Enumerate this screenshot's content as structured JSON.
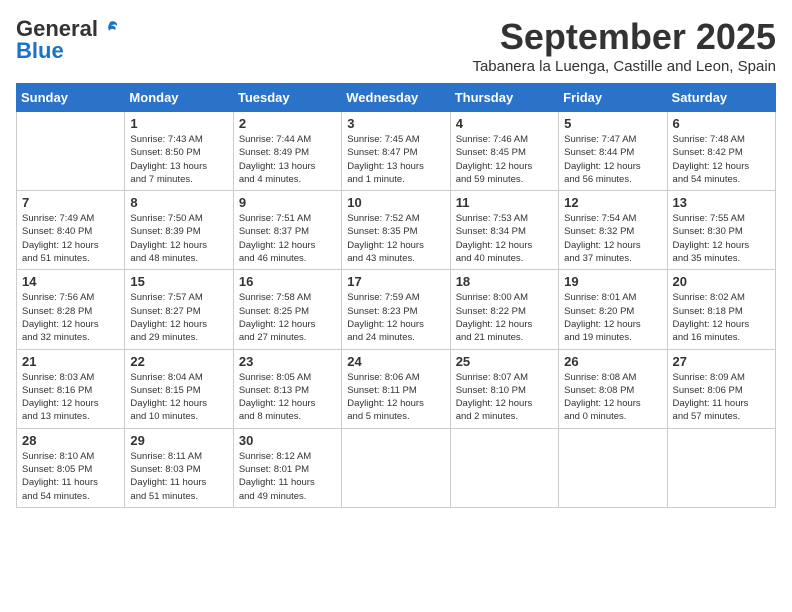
{
  "header": {
    "logo_general": "General",
    "logo_blue": "Blue",
    "month": "September 2025",
    "location": "Tabanera la Luenga, Castille and Leon, Spain"
  },
  "weekdays": [
    "Sunday",
    "Monday",
    "Tuesday",
    "Wednesday",
    "Thursday",
    "Friday",
    "Saturday"
  ],
  "weeks": [
    [
      {
        "day": "",
        "info": ""
      },
      {
        "day": "1",
        "info": "Sunrise: 7:43 AM\nSunset: 8:50 PM\nDaylight: 13 hours\nand 7 minutes."
      },
      {
        "day": "2",
        "info": "Sunrise: 7:44 AM\nSunset: 8:49 PM\nDaylight: 13 hours\nand 4 minutes."
      },
      {
        "day": "3",
        "info": "Sunrise: 7:45 AM\nSunset: 8:47 PM\nDaylight: 13 hours\nand 1 minute."
      },
      {
        "day": "4",
        "info": "Sunrise: 7:46 AM\nSunset: 8:45 PM\nDaylight: 12 hours\nand 59 minutes."
      },
      {
        "day": "5",
        "info": "Sunrise: 7:47 AM\nSunset: 8:44 PM\nDaylight: 12 hours\nand 56 minutes."
      },
      {
        "day": "6",
        "info": "Sunrise: 7:48 AM\nSunset: 8:42 PM\nDaylight: 12 hours\nand 54 minutes."
      }
    ],
    [
      {
        "day": "7",
        "info": "Sunrise: 7:49 AM\nSunset: 8:40 PM\nDaylight: 12 hours\nand 51 minutes."
      },
      {
        "day": "8",
        "info": "Sunrise: 7:50 AM\nSunset: 8:39 PM\nDaylight: 12 hours\nand 48 minutes."
      },
      {
        "day": "9",
        "info": "Sunrise: 7:51 AM\nSunset: 8:37 PM\nDaylight: 12 hours\nand 46 minutes."
      },
      {
        "day": "10",
        "info": "Sunrise: 7:52 AM\nSunset: 8:35 PM\nDaylight: 12 hours\nand 43 minutes."
      },
      {
        "day": "11",
        "info": "Sunrise: 7:53 AM\nSunset: 8:34 PM\nDaylight: 12 hours\nand 40 minutes."
      },
      {
        "day": "12",
        "info": "Sunrise: 7:54 AM\nSunset: 8:32 PM\nDaylight: 12 hours\nand 37 minutes."
      },
      {
        "day": "13",
        "info": "Sunrise: 7:55 AM\nSunset: 8:30 PM\nDaylight: 12 hours\nand 35 minutes."
      }
    ],
    [
      {
        "day": "14",
        "info": "Sunrise: 7:56 AM\nSunset: 8:28 PM\nDaylight: 12 hours\nand 32 minutes."
      },
      {
        "day": "15",
        "info": "Sunrise: 7:57 AM\nSunset: 8:27 PM\nDaylight: 12 hours\nand 29 minutes."
      },
      {
        "day": "16",
        "info": "Sunrise: 7:58 AM\nSunset: 8:25 PM\nDaylight: 12 hours\nand 27 minutes."
      },
      {
        "day": "17",
        "info": "Sunrise: 7:59 AM\nSunset: 8:23 PM\nDaylight: 12 hours\nand 24 minutes."
      },
      {
        "day": "18",
        "info": "Sunrise: 8:00 AM\nSunset: 8:22 PM\nDaylight: 12 hours\nand 21 minutes."
      },
      {
        "day": "19",
        "info": "Sunrise: 8:01 AM\nSunset: 8:20 PM\nDaylight: 12 hours\nand 19 minutes."
      },
      {
        "day": "20",
        "info": "Sunrise: 8:02 AM\nSunset: 8:18 PM\nDaylight: 12 hours\nand 16 minutes."
      }
    ],
    [
      {
        "day": "21",
        "info": "Sunrise: 8:03 AM\nSunset: 8:16 PM\nDaylight: 12 hours\nand 13 minutes."
      },
      {
        "day": "22",
        "info": "Sunrise: 8:04 AM\nSunset: 8:15 PM\nDaylight: 12 hours\nand 10 minutes."
      },
      {
        "day": "23",
        "info": "Sunrise: 8:05 AM\nSunset: 8:13 PM\nDaylight: 12 hours\nand 8 minutes."
      },
      {
        "day": "24",
        "info": "Sunrise: 8:06 AM\nSunset: 8:11 PM\nDaylight: 12 hours\nand 5 minutes."
      },
      {
        "day": "25",
        "info": "Sunrise: 8:07 AM\nSunset: 8:10 PM\nDaylight: 12 hours\nand 2 minutes."
      },
      {
        "day": "26",
        "info": "Sunrise: 8:08 AM\nSunset: 8:08 PM\nDaylight: 12 hours\nand 0 minutes."
      },
      {
        "day": "27",
        "info": "Sunrise: 8:09 AM\nSunset: 8:06 PM\nDaylight: 11 hours\nand 57 minutes."
      }
    ],
    [
      {
        "day": "28",
        "info": "Sunrise: 8:10 AM\nSunset: 8:05 PM\nDaylight: 11 hours\nand 54 minutes."
      },
      {
        "day": "29",
        "info": "Sunrise: 8:11 AM\nSunset: 8:03 PM\nDaylight: 11 hours\nand 51 minutes."
      },
      {
        "day": "30",
        "info": "Sunrise: 8:12 AM\nSunset: 8:01 PM\nDaylight: 11 hours\nand 49 minutes."
      },
      {
        "day": "",
        "info": ""
      },
      {
        "day": "",
        "info": ""
      },
      {
        "day": "",
        "info": ""
      },
      {
        "day": "",
        "info": ""
      }
    ]
  ]
}
